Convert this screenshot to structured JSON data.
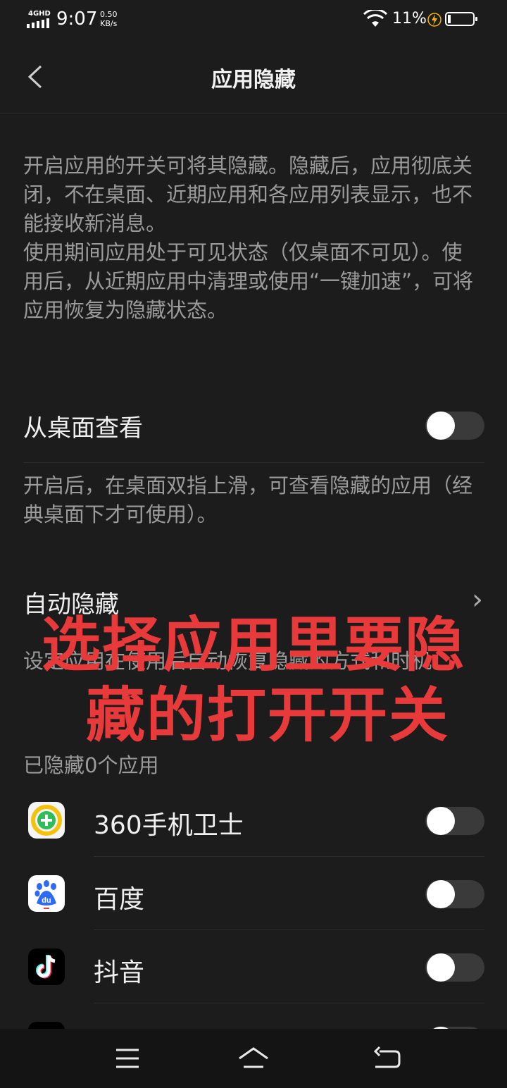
{
  "status_bar": {
    "network": "4GHD",
    "time": "9:07",
    "speed_value": "0.50",
    "speed_unit": "KB/s",
    "battery_pct": "11%",
    "icons": [
      "signal-icon",
      "wifi-icon",
      "charging-icon",
      "battery-icon"
    ]
  },
  "header": {
    "title": "应用隐藏",
    "back_icon": "chevron-left-icon"
  },
  "intro": {
    "line1": "开启应用的开关可将其隐藏。隐藏后，应用彻底关闭，不在桌面、近期应用和各应用列表显示，也不能接收新消息。",
    "line2": "使用期间应用处于可见状态（仅桌面不可见）。使用后，从近期应用中清理或使用“一键加速”，可将应用恢复为隐藏状态。"
  },
  "view_from_desktop": {
    "label": "从桌面查看",
    "enabled": false,
    "desc": "开启后，在桌面双指上滑，可查看隐藏的应用（经典桌面下才可使用）。"
  },
  "auto_hide": {
    "label": "自动隐藏",
    "desc": "设定应用在使用后自动恢复隐藏的方式和时机。",
    "chevron": "chevron-right-icon"
  },
  "hidden_count_label": "已隐藏0个应用",
  "apps": [
    {
      "name": "360手机卫士",
      "icon": "360-security-icon",
      "enabled": false
    },
    {
      "name": "百度",
      "icon": "baidu-icon",
      "enabled": false
    },
    {
      "name": "抖音",
      "icon": "douyin-icon",
      "enabled": false
    }
  ],
  "overlay_text": {
    "line1": "选择应用里要隐",
    "line2": "藏的打开开关"
  },
  "nav_bar": [
    "menu-icon",
    "home-icon",
    "back-icon"
  ],
  "colors": {
    "background": "#1c1c1c",
    "overlay_red": "#e83a3a",
    "secondary_text": "#9b9b9b"
  }
}
